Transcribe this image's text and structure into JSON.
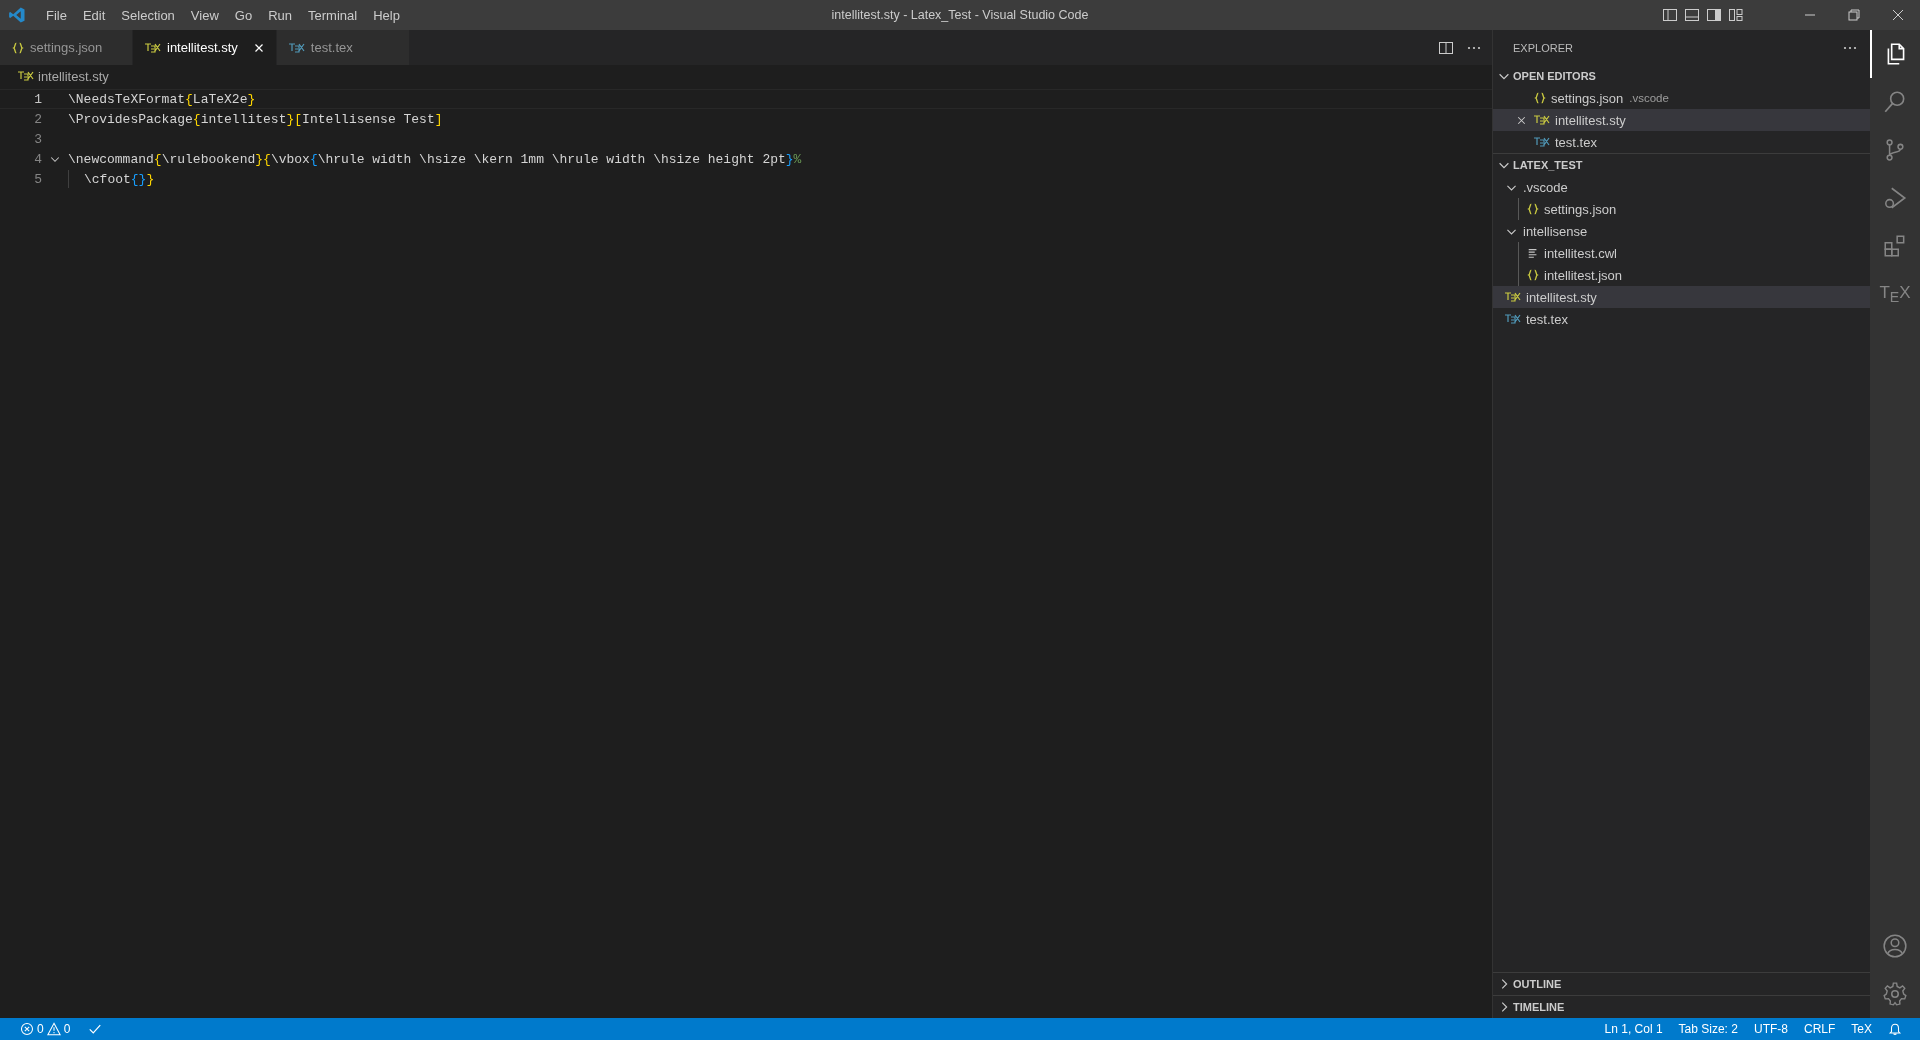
{
  "window": {
    "title": "intellitest.sty - Latex_Test - Visual Studio Code"
  },
  "menu": [
    "File",
    "Edit",
    "Selection",
    "View",
    "Go",
    "Run",
    "Terminal",
    "Help"
  ],
  "tabs": [
    {
      "label": "settings.json",
      "kind": "json",
      "selected": false
    },
    {
      "label": "intellitest.sty",
      "kind": "sty",
      "selected": true
    },
    {
      "label": "test.tex",
      "kind": "tex",
      "selected": false
    }
  ],
  "breadcrumb": {
    "label": "intellitest.sty",
    "kind": "sty"
  },
  "editor": {
    "lines": [
      {
        "number": "1",
        "current": true,
        "foldable": false,
        "indent": false,
        "tokens": [
          {
            "text": "\\NeedsTeXFormat",
            "color": "#d4d4d4"
          },
          {
            "text": "{",
            "color": "#ffd700"
          },
          {
            "text": "LaTeX2e",
            "color": "#d4d4d4"
          },
          {
            "text": "}",
            "color": "#ffd700"
          }
        ]
      },
      {
        "number": "2",
        "current": false,
        "foldable": false,
        "indent": false,
        "tokens": [
          {
            "text": "\\ProvidesPackage",
            "color": "#d4d4d4"
          },
          {
            "text": "{",
            "color": "#ffd700"
          },
          {
            "text": "intellitest",
            "color": "#d4d4d4"
          },
          {
            "text": "}[",
            "color": "#ffd700"
          },
          {
            "text": "Intellisense Test",
            "color": "#d4d4d4"
          },
          {
            "text": "]",
            "color": "#ffd700"
          }
        ]
      },
      {
        "number": "3",
        "current": false,
        "foldable": false,
        "indent": false
      },
      {
        "number": "4",
        "current": false,
        "foldable": true,
        "indent": false,
        "tokens": [
          {
            "text": "\\newcommand",
            "color": "#d4d4d4"
          },
          {
            "text": "{",
            "color": "#ffd700"
          },
          {
            "text": "\\rulebookend",
            "color": "#d4d4d4"
          },
          {
            "text": "}{",
            "color": "#ffd700"
          },
          {
            "text": "\\vbox",
            "color": "#d4d4d4"
          },
          {
            "text": "{",
            "color": "#179fff"
          },
          {
            "text": "\\hrule width \\hsize \\kern 1mm \\hrule width \\hsize height 2pt",
            "color": "#d4d4d4"
          },
          {
            "text": "}",
            "color": "#179fff"
          },
          {
            "text": "%",
            "kind": "comment"
          }
        ]
      },
      {
        "number": "5",
        "current": false,
        "foldable": false,
        "indent": true,
        "tokens": [
          {
            "text": "\\cfoot",
            "color": "#d4d4d4"
          },
          {
            "text": "{}",
            "color": "#179fff"
          },
          {
            "text": "}",
            "color": "#ffd700"
          }
        ]
      }
    ]
  },
  "explorer": {
    "title": "EXPLORER",
    "open_editors": {
      "title": "OPEN EDITORS",
      "expanded": true,
      "items": [
        {
          "label": "settings.json",
          "description": ".vscode",
          "kind": "json",
          "selected": false
        },
        {
          "label": "intellitest.sty",
          "kind": "sty",
          "selected": true
        },
        {
          "label": "test.tex",
          "kind": "tex",
          "selected": false
        }
      ]
    },
    "folder": {
      "title": "LATEX_TEST",
      "expanded": true,
      "items": [
        {
          "label": ".vscode",
          "kind": "folder",
          "expanded": true,
          "selected": false,
          "children": [
            {
              "label": "settings.json",
              "kind": "json",
              "selected": false
            }
          ]
        },
        {
          "label": "intellisense",
          "kind": "folder",
          "expanded": true,
          "selected": false,
          "children": [
            {
              "label": "intellitest.cwl",
              "kind": "lines",
              "selected": false
            },
            {
              "label": "intellitest.json",
              "kind": "json",
              "selected": false
            }
          ]
        },
        {
          "label": "intellitest.sty",
          "kind": "sty",
          "selected": true
        },
        {
          "label": "test.tex",
          "kind": "tex",
          "selected": false
        }
      ]
    },
    "outline": {
      "title": "OUTLINE",
      "expanded": false
    },
    "timeline": {
      "title": "TIMELINE",
      "expanded": false
    }
  },
  "activity_bar": {
    "tex_label": "T$_{E}$X"
  },
  "status_bar": {
    "errors": "0",
    "warnings": "0",
    "right": [
      "Ln 1, Col 1",
      "Tab Size: 2",
      "UTF-8",
      "CRLF",
      "TeX"
    ]
  }
}
